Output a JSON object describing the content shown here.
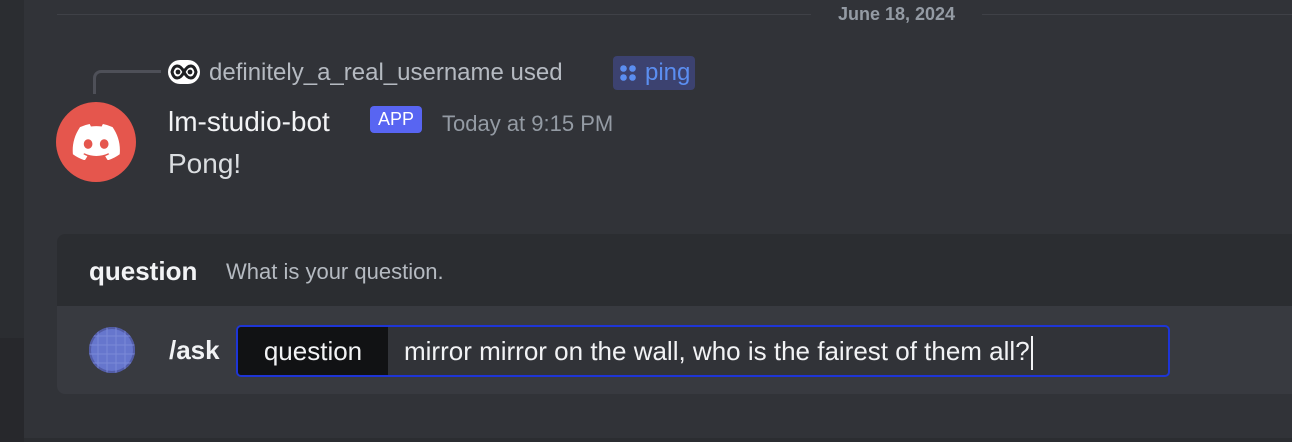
{
  "divider": {
    "date": "June 18, 2024"
  },
  "reply": {
    "username": "definitely_a_real_username",
    "action": "used",
    "command": "ping",
    "command_icon": "slash-command-icon"
  },
  "message": {
    "author": "lm-studio-bot",
    "badge": "APP",
    "timestamp": "Today at 9:15 PM",
    "content": "Pong!",
    "avatar_icon": "discord-logo-icon",
    "avatar_color": "#e5564d"
  },
  "composer": {
    "option_name": "question",
    "option_description": "What is your question.",
    "command": "/ask",
    "field_label": "question",
    "field_value": "mirror mirror on the wall, who is the fairest of them all?",
    "field_border_color": "#1e35d6"
  },
  "colors": {
    "background": "#313338",
    "accent": "#5865f2",
    "command_link": "#5b8ef1"
  }
}
